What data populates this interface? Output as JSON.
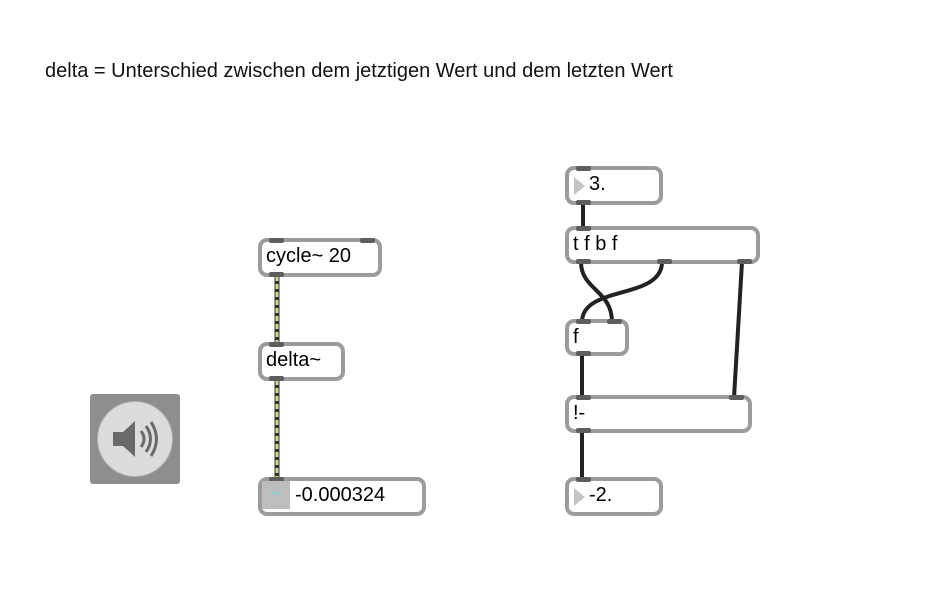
{
  "comment": "delta = Unterschied zwischen dem jetztigen Wert und dem letzten Wert",
  "objects": {
    "cycle": "cycle~ 20",
    "delta": "delta~",
    "signal_number": "-0.000324",
    "float_in": "3.",
    "trigger": "t f b f",
    "float_store": "f",
    "rminus": "!-",
    "float_out": "-2."
  },
  "icons": {
    "signal_wave": "~",
    "speaker": "speaker-icon"
  },
  "colors": {
    "signal_cord": "#c8dc8c",
    "control_cord": "#222222",
    "box_border": "#9c9c9c",
    "speaker_bg": "#8e8e8e"
  }
}
